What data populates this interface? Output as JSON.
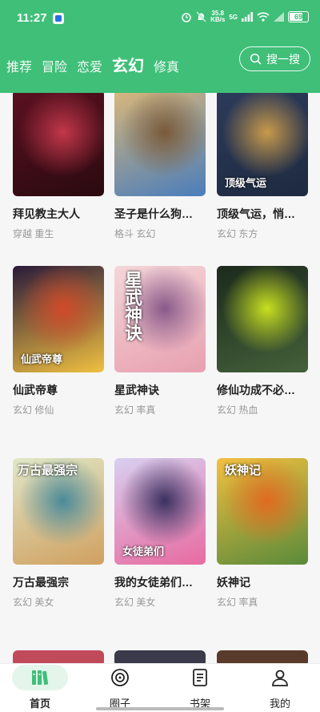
{
  "status": {
    "time": "11:27",
    "netspeed_value": "35.8",
    "netspeed_unit": "KB/s",
    "signal": "5G",
    "battery": "69"
  },
  "tabs": [
    {
      "label": "推荐",
      "active": false
    },
    {
      "label": "冒险",
      "active": false
    },
    {
      "label": "恋爱",
      "active": false
    },
    {
      "label": "玄幻",
      "active": true
    },
    {
      "label": "修真",
      "active": false
    }
  ],
  "search": {
    "label": "搜一搜"
  },
  "comics": [
    {
      "title": "拜见教主大人",
      "tags": "穿越 重生",
      "cover": "c1",
      "colors": [
        "#5b1020",
        "#c2374a",
        "#2a0a10"
      ]
    },
    {
      "title": "圣子是什么狗…",
      "tags": "格斗 玄幻",
      "cover": "c2",
      "colors": [
        "#d9b77a",
        "#7a5a3a",
        "#4a7dbb"
      ]
    },
    {
      "title": "顶级气运，悄…",
      "tags": "玄幻 东方",
      "cover": "c3",
      "colors": [
        "#2d3b5c",
        "#c89a4a",
        "#1d2a40"
      ]
    },
    {
      "title": "仙武帝尊",
      "tags": "玄幻 修仙",
      "cover": "c4",
      "colors": [
        "#2a1a3a",
        "#d04a2a",
        "#f0c040"
      ]
    },
    {
      "title": "星武神诀",
      "tags": "玄幻 率真",
      "cover": "c5",
      "colors": [
        "#f3d6d9",
        "#8a5a8a",
        "#e8a0b0"
      ]
    },
    {
      "title": "修仙功成不必…",
      "tags": "玄幻 热血",
      "cover": "c6",
      "colors": [
        "#1c2a1c",
        "#c8e020",
        "#44603a"
      ]
    },
    {
      "title": "万古最强宗",
      "tags": "玄幻 美女",
      "cover": "c7",
      "colors": [
        "#e0e8c8",
        "#4a8a9a",
        "#d0a060"
      ]
    },
    {
      "title": "我的女徒弟们…",
      "tags": "玄幻 美女",
      "cover": "c8",
      "colors": [
        "#d8d0f0",
        "#3a3060",
        "#e86aa0"
      ]
    },
    {
      "title": "妖神记",
      "tags": "玄幻 率真",
      "cover": "c9",
      "colors": [
        "#f2c040",
        "#e06a20",
        "#5a8a3a"
      ]
    }
  ],
  "cover_text": {
    "c3": "顶级气运",
    "c4": "仙武帝尊",
    "c5": "星武神诀",
    "c7": "万古最强宗",
    "c8": "女徒弟们",
    "c9": "妖神记"
  },
  "nav": [
    {
      "label": "首页",
      "icon": "home-books-icon",
      "active": true
    },
    {
      "label": "圈子",
      "icon": "target-icon",
      "active": false
    },
    {
      "label": "书架",
      "icon": "bookshelf-icon",
      "active": false
    },
    {
      "label": "我的",
      "icon": "user-icon",
      "active": false
    }
  ]
}
